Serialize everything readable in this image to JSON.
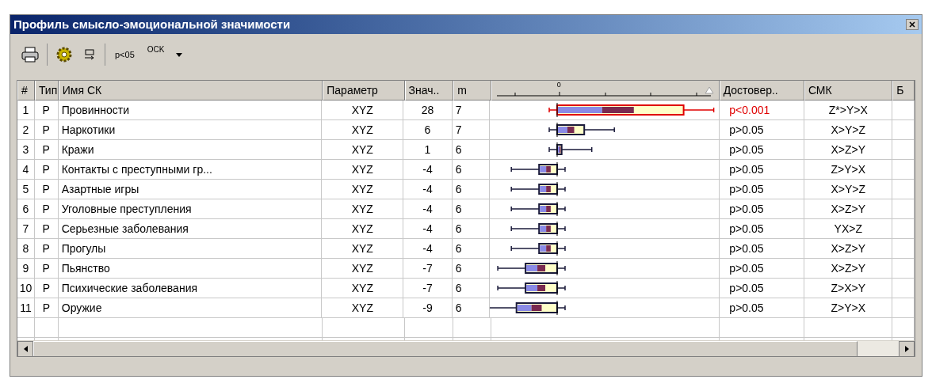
{
  "window": {
    "title": "Профиль смысло-эмоциональной значимости"
  },
  "toolbar": {
    "labels": [
      "p<05",
      "OCK"
    ]
  },
  "table": {
    "columns": [
      "#",
      "Тип",
      "Имя СК",
      "Параметр",
      "Знач..",
      "m",
      "0",
      "Достовер..",
      "СМК",
      "Б"
    ],
    "rows": [
      {
        "num": "1",
        "type": "P",
        "name": "Провинности",
        "param": "XYZ",
        "value": "28",
        "m": "7",
        "p": "p<0.001",
        "smk": "Z*>Y>X",
        "significant": true
      },
      {
        "num": "2",
        "type": "P",
        "name": "Наркотики",
        "param": "XYZ",
        "value": "6",
        "m": "7",
        "p": "p>0.05",
        "smk": "X>Y>Z",
        "significant": false
      },
      {
        "num": "3",
        "type": "P",
        "name": "Кражи",
        "param": "XYZ",
        "value": "1",
        "m": "6",
        "p": "p>0.05",
        "smk": "X>Z>Y",
        "significant": false
      },
      {
        "num": "4",
        "type": "P",
        "name": "Контакты с преступными гр...",
        "param": "XYZ",
        "value": "-4",
        "m": "6",
        "p": "p>0.05",
        "smk": "Z>Y>X",
        "significant": false
      },
      {
        "num": "5",
        "type": "P",
        "name": "Азартные игры",
        "param": "XYZ",
        "value": "-4",
        "m": "6",
        "p": "p>0.05",
        "smk": "X>Y>Z",
        "significant": false
      },
      {
        "num": "6",
        "type": "P",
        "name": "Уголовные преступления",
        "param": "XYZ",
        "value": "-4",
        "m": "6",
        "p": "p>0.05",
        "smk": "X>Z>Y",
        "significant": false
      },
      {
        "num": "7",
        "type": "P",
        "name": "Серьезные заболевания",
        "param": "XYZ",
        "value": "-4",
        "m": "6",
        "p": "p>0.05",
        "smk": "YX>Z",
        "significant": false
      },
      {
        "num": "8",
        "type": "P",
        "name": "Прогулы",
        "param": "XYZ",
        "value": "-4",
        "m": "6",
        "p": "p>0.05",
        "smk": "X>Z>Y",
        "significant": false
      },
      {
        "num": "9",
        "type": "P",
        "name": "Пьянство",
        "param": "XYZ",
        "value": "-7",
        "m": "6",
        "p": "p>0.05",
        "smk": "X>Z>Y",
        "significant": false
      },
      {
        "num": "10",
        "type": "P",
        "name": "Психические заболевания",
        "param": "XYZ",
        "value": "-7",
        "m": "6",
        "p": "p>0.05",
        "smk": "Z>X>Y",
        "significant": false
      },
      {
        "num": "11",
        "type": "P",
        "name": "Оружие",
        "param": "XYZ",
        "value": "-9",
        "m": "6",
        "p": "p>0.05",
        "smk": "Z>Y>X",
        "significant": false
      }
    ]
  }
}
